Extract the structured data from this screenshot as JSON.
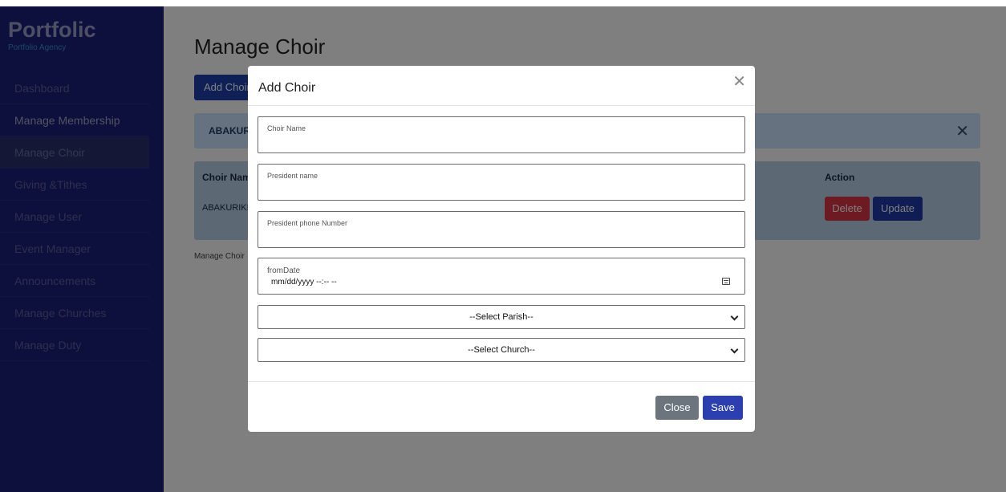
{
  "sidebar": {
    "brand_title": "Portfolic",
    "brand_subtitle": "Portfolio Agency",
    "items": [
      {
        "label": "Dashboard"
      },
      {
        "label": "Manage Membership"
      },
      {
        "label": "Manage Choir"
      },
      {
        "label": "Giving &Tithes"
      },
      {
        "label": "Manage User"
      },
      {
        "label": "Event Manager"
      },
      {
        "label": "Announcements"
      },
      {
        "label": "Manage Churches"
      },
      {
        "label": "Manage Duty"
      }
    ]
  },
  "main": {
    "title": "Manage Choir",
    "add_button": "Add Choir",
    "alert_text": "ABAKURIKIYE",
    "table": {
      "headers": [
        "Choir Name",
        "Action"
      ],
      "rows": [
        {
          "name": "ABAKURIKIYE"
        }
      ],
      "delete_label": "Delete",
      "update_label": "Update"
    },
    "footer_text": "Manage Choir"
  },
  "modal": {
    "title": "Add Choir",
    "choir_name_label": "Choir Name",
    "president_name_label": "President name",
    "president_phone_label": "President phone Number",
    "from_date_label": "fromDate",
    "from_date_placeholder": "mm/dd/yyyy --:-- --",
    "parish_select": "--Select Parish--",
    "church_select": "--Select Church--",
    "close_label": "Close",
    "save_label": "Save"
  },
  "colors": {
    "sidebar": "#1b2178",
    "primary_button": "#1e40af",
    "danger_button": "#dc3545",
    "secondary_button": "#6c757d",
    "alert_bg": "#cce5ff"
  }
}
